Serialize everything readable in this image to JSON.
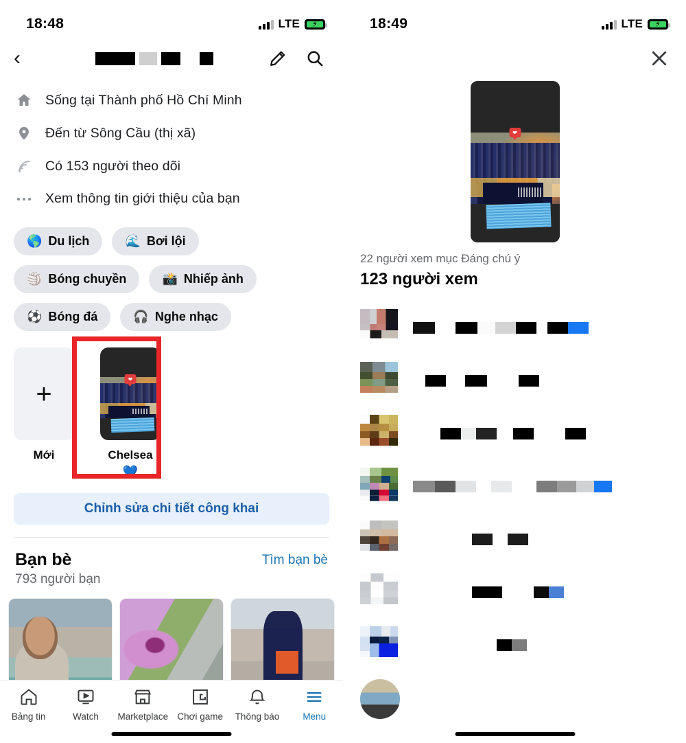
{
  "left": {
    "status": {
      "time": "18:48",
      "network": "LTE",
      "signal_icon": "cellular-bars-icon",
      "battery_icon": "battery-charging-icon"
    },
    "header": {
      "back_icon": "back-chevron-icon",
      "title_redacted": "■■■ ■",
      "edit_icon": "pencil-icon",
      "search_icon": "search-icon"
    },
    "info_rows": [
      {
        "icon": "home-icon",
        "text": "Sống tại Thành phố Hồ Chí Minh"
      },
      {
        "icon": "location-pin-icon",
        "text": "Đến từ Sông Cầu (thị xã)"
      },
      {
        "icon": "rss-followers-icon",
        "text": "Có 153 người theo dõi"
      },
      {
        "icon": "ellipsis-icon",
        "text": "Xem thông tin giới thiệu của bạn"
      }
    ],
    "chips": [
      {
        "emoji": "🌎",
        "label": "Du lịch"
      },
      {
        "emoji": "🌊",
        "label": "Bơi lội"
      },
      {
        "emoji": "🏐",
        "label": "Bóng chuyền"
      },
      {
        "emoji": "📸",
        "label": "Nhiếp ảnh"
      },
      {
        "emoji": "⚽",
        "label": "Bóng đá"
      },
      {
        "emoji": "🎧",
        "label": "Nghe nhạc"
      }
    ],
    "highlights": [
      {
        "type": "new",
        "plus": "+",
        "label": "Mới"
      },
      {
        "type": "story",
        "label": "Chelsea",
        "sub_emoji": "💙"
      }
    ],
    "edit_public_details": "Chỉnh sửa chi tiết công khai",
    "friends": {
      "title": "Bạn bè",
      "count": "793 người bạn",
      "link": "Tìm bạn bè",
      "cards": [
        {
          "photo": "portrait-rooftop-photo"
        },
        {
          "photo": "purple-flower-photo"
        },
        {
          "photo": "graduation-portrait-photo"
        }
      ]
    },
    "tabs": [
      {
        "icon": "home-outline-icon",
        "label": "Bảng tin",
        "active": false
      },
      {
        "icon": "watch-play-icon",
        "label": "Watch",
        "active": false
      },
      {
        "icon": "marketplace-store-icon",
        "label": "Marketplace",
        "active": false
      },
      {
        "icon": "gaming-icon",
        "label": "Chơi game",
        "active": false
      },
      {
        "icon": "bell-icon",
        "label": "Thông báo",
        "active": false
      },
      {
        "icon": "hamburger-menu-icon",
        "label": "Menu",
        "active": true
      }
    ]
  },
  "right": {
    "status": {
      "time": "18:49",
      "network": "LTE",
      "signal_icon": "cellular-bars-icon",
      "battery_icon": "battery-charging-icon"
    },
    "close_icon": "close-x-icon",
    "story_preview": "chelsea-trophy-story-thumbnail",
    "viewers": {
      "highlight_note": "22 người xem mục Đáng chú ý",
      "total": "123 người xem"
    },
    "viewer_rows": [
      {
        "avatar": "pa1",
        "name_redacted": true
      },
      {
        "avatar": "pa2",
        "name_redacted": true
      },
      {
        "avatar": "pa3",
        "name_redacted": true
      },
      {
        "avatar": "pa4",
        "name_redacted": true
      },
      {
        "avatar": "pa5",
        "name_redacted": true
      },
      {
        "avatar": "pa6",
        "name_redacted": true
      },
      {
        "avatar": "pa7",
        "name_redacted": true
      }
    ]
  },
  "annotations": {
    "color": "#e8262a",
    "boxes": [
      {
        "target": "chelsea-highlight"
      },
      {
        "target": "viewer-count-header"
      }
    ]
  }
}
